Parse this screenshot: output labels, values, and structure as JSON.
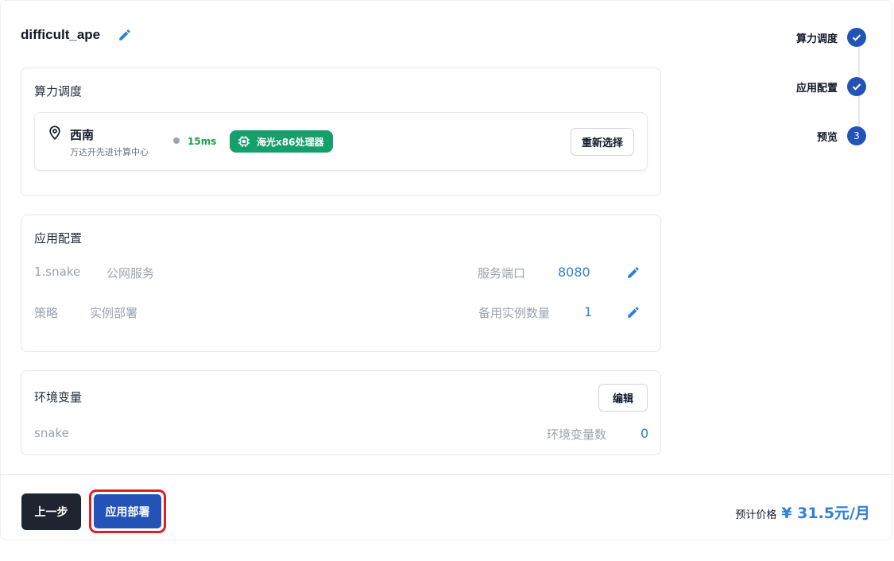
{
  "header": {
    "title": "difficult_ape"
  },
  "compute": {
    "title": "算力调度",
    "region": "西南",
    "datacenter": "万达开先进计算中心",
    "latency": "15ms",
    "cpu": "海光x86处理器",
    "reselect_label": "重新选择"
  },
  "app": {
    "title": "应用配置",
    "rows": [
      {
        "name": "1.snake",
        "type": "公网服务",
        "field": "服务端口",
        "value": "8080"
      },
      {
        "name": "策略",
        "type": "实例部署",
        "field": "备用实例数量",
        "value": "1"
      }
    ]
  },
  "env": {
    "title": "环境变量",
    "edit_label": "编辑",
    "name": "snake",
    "count_label": "环境变量数",
    "count": "0"
  },
  "steps": [
    {
      "label": "算力调度",
      "status": "done"
    },
    {
      "label": "应用配置",
      "status": "done"
    },
    {
      "label": "预览",
      "status": "current",
      "number": "3"
    }
  ],
  "footer": {
    "prev_label": "上一步",
    "deploy_label": "应用部署",
    "price_label": "预计价格",
    "price_value": "¥ 31.5元/月"
  },
  "colors": {
    "primary": "#2453b8",
    "link": "#2f80d6",
    "success": "#15a06b",
    "highlight": "#e11d1d"
  }
}
